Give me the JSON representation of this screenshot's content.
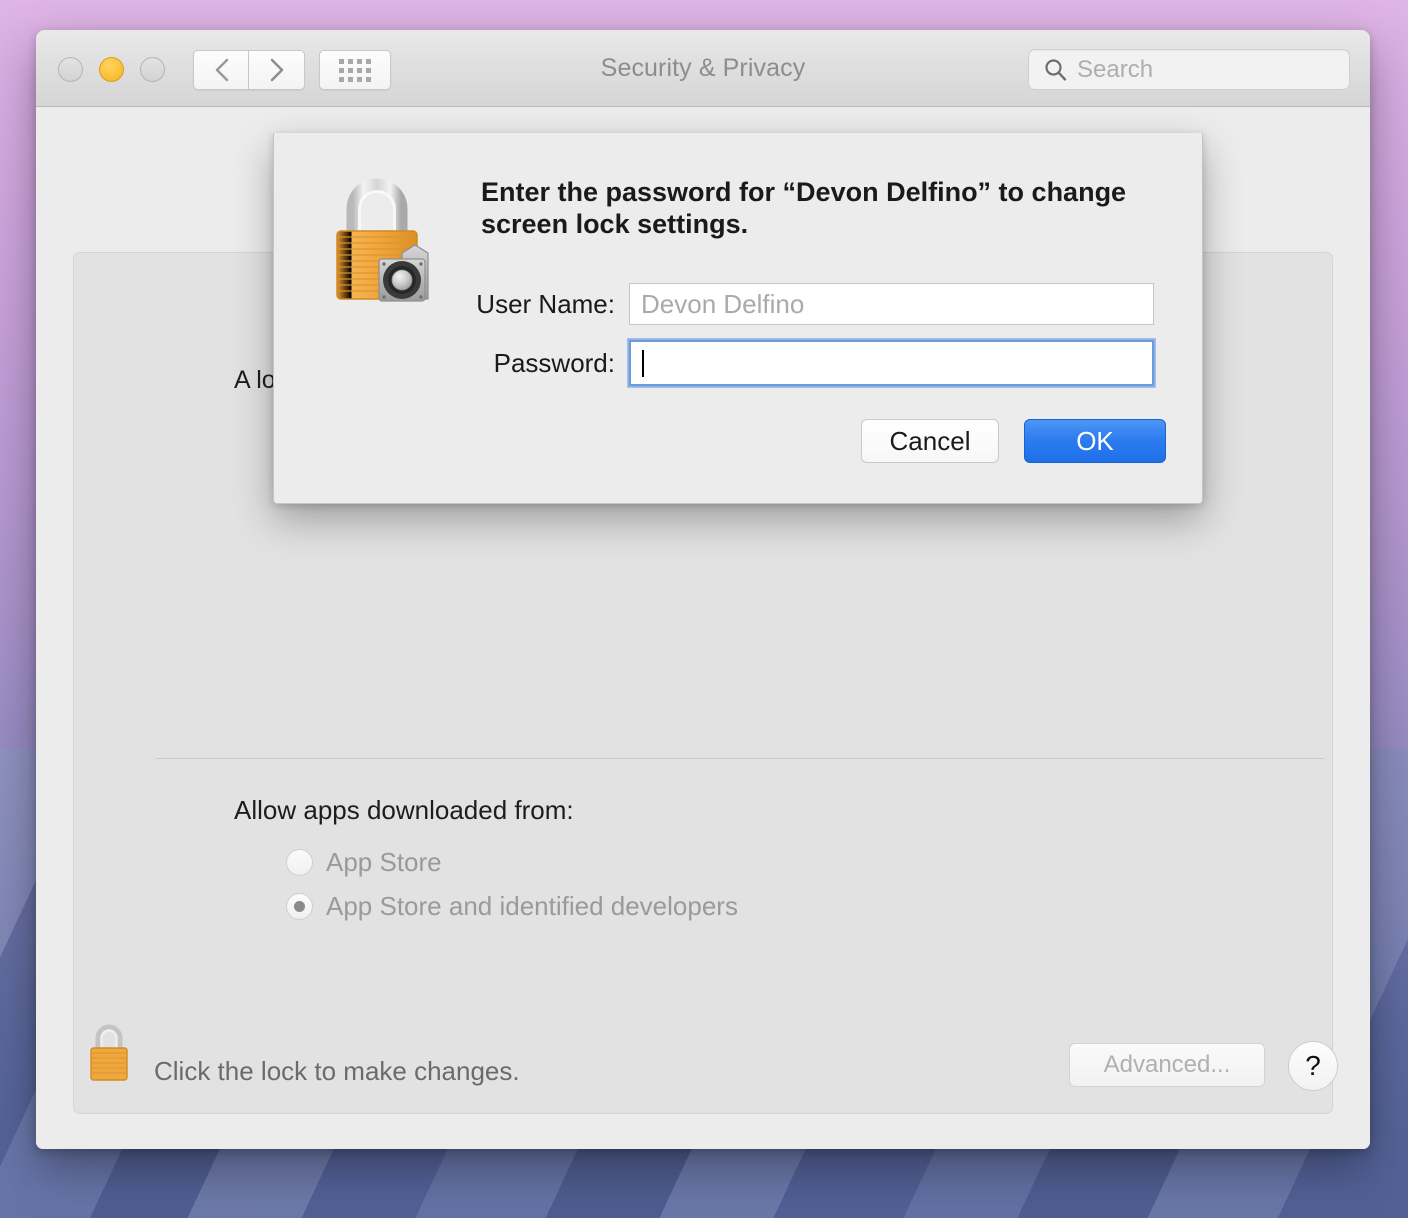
{
  "window": {
    "title": "Security & Privacy",
    "traffic_lights": {
      "close": "close-button",
      "minimize": "minimize-button",
      "zoom": "zoom-button"
    },
    "nav": {
      "back_icon": "chevron-left-icon",
      "forward_icon": "chevron-right-icon",
      "show_all_icon": "grid-icon"
    },
    "search": {
      "icon": "search-icon",
      "placeholder": "Search",
      "value": ""
    }
  },
  "panel": {
    "clipped_text": "A lo",
    "allow_label": "Allow apps downloaded from:",
    "radios": [
      {
        "label": "App Store",
        "selected": false
      },
      {
        "label": "App Store and identified developers",
        "selected": true
      }
    ]
  },
  "footer": {
    "lock_icon": "lock-closed-icon",
    "lock_text": "Click the lock to make changes.",
    "advanced_label": "Advanced...",
    "help_label": "?"
  },
  "sheet": {
    "icon": "padlock-with-safe-dial-icon",
    "headline": "Enter the password for “Devon Delfino” to change screen lock settings.",
    "username_label": "User Name:",
    "username_value": "Devon Delfino",
    "password_label": "Password:",
    "password_value": "",
    "cancel_label": "Cancel",
    "ok_label": "OK"
  },
  "colors": {
    "accent_blue": "#2b7bef",
    "focus_ring": "#6d9ae0",
    "minimize_yellow": "#fcc13d",
    "lock_gold": "#f0a73c",
    "window_bg": "#ececec",
    "panel_bg": "#e2e2e2"
  }
}
